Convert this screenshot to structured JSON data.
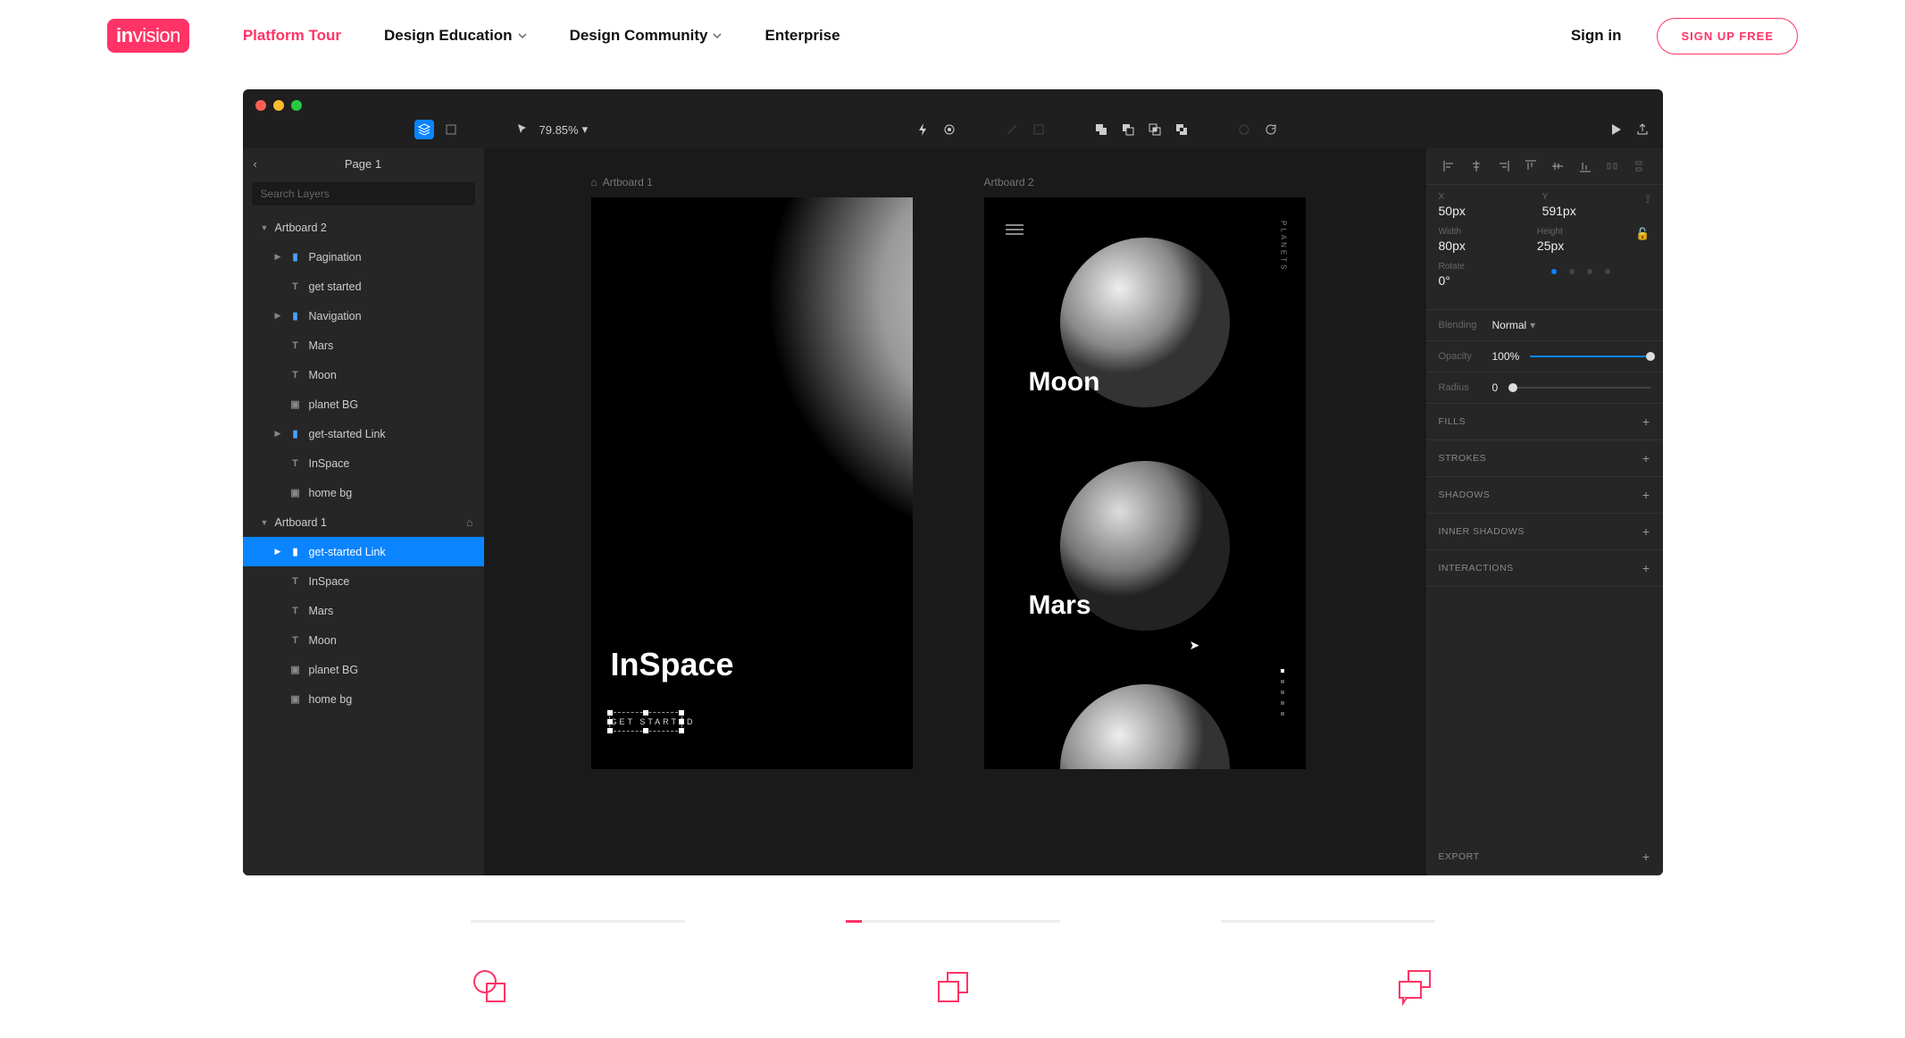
{
  "nav": {
    "items": [
      "Platform Tour",
      "Design Education",
      "Design Community",
      "Enterprise"
    ],
    "signin": "Sign in",
    "signup": "SIGN UP FREE"
  },
  "app": {
    "page_title": "Page 1",
    "search_placeholder": "Search Layers",
    "zoom": "79.85%",
    "layers": {
      "artboard2": {
        "name": "Artboard 2",
        "items": [
          {
            "kind": "folder",
            "label": "Pagination"
          },
          {
            "kind": "text",
            "label": "get started"
          },
          {
            "kind": "folder",
            "label": "Navigation"
          },
          {
            "kind": "text",
            "label": "Mars"
          },
          {
            "kind": "text",
            "label": "Moon"
          },
          {
            "kind": "image",
            "label": "planet BG"
          },
          {
            "kind": "folder",
            "label": "get-started Link"
          },
          {
            "kind": "text",
            "label": "InSpace"
          },
          {
            "kind": "image",
            "label": "home bg"
          }
        ]
      },
      "artboard1": {
        "name": "Artboard 1",
        "items": [
          {
            "kind": "folder",
            "label": "get-started Link",
            "selected": true
          },
          {
            "kind": "text",
            "label": "InSpace"
          },
          {
            "kind": "text",
            "label": "Mars"
          },
          {
            "kind": "text",
            "label": "Moon"
          },
          {
            "kind": "image",
            "label": "planet BG"
          },
          {
            "kind": "image",
            "label": "home bg"
          }
        ]
      }
    },
    "canvas": {
      "ab1": {
        "label": "Artboard 1",
        "title": "InSpace",
        "cta": "GET STARTED"
      },
      "ab2": {
        "label": "Artboard 2",
        "moon": "Moon",
        "mars": "Mars",
        "side": "PLANETS"
      }
    },
    "inspector": {
      "x": {
        "label": "X",
        "value": "50px"
      },
      "y": {
        "label": "Y",
        "value": "591px"
      },
      "w": {
        "label": "Width",
        "value": "80px"
      },
      "h": {
        "label": "Height",
        "value": "25px"
      },
      "rotate": {
        "label": "Rotate",
        "value": "0°"
      },
      "blending": {
        "label": "Blending",
        "value": "Normal"
      },
      "opacity": {
        "label": "Opacity",
        "value": "100%"
      },
      "radius": {
        "label": "Radius",
        "value": "0"
      },
      "sections": [
        "FILLS",
        "STROKES",
        "SHADOWS",
        "INNER SHADOWS",
        "INTERACTIONS"
      ],
      "export": "EXPORT"
    }
  }
}
